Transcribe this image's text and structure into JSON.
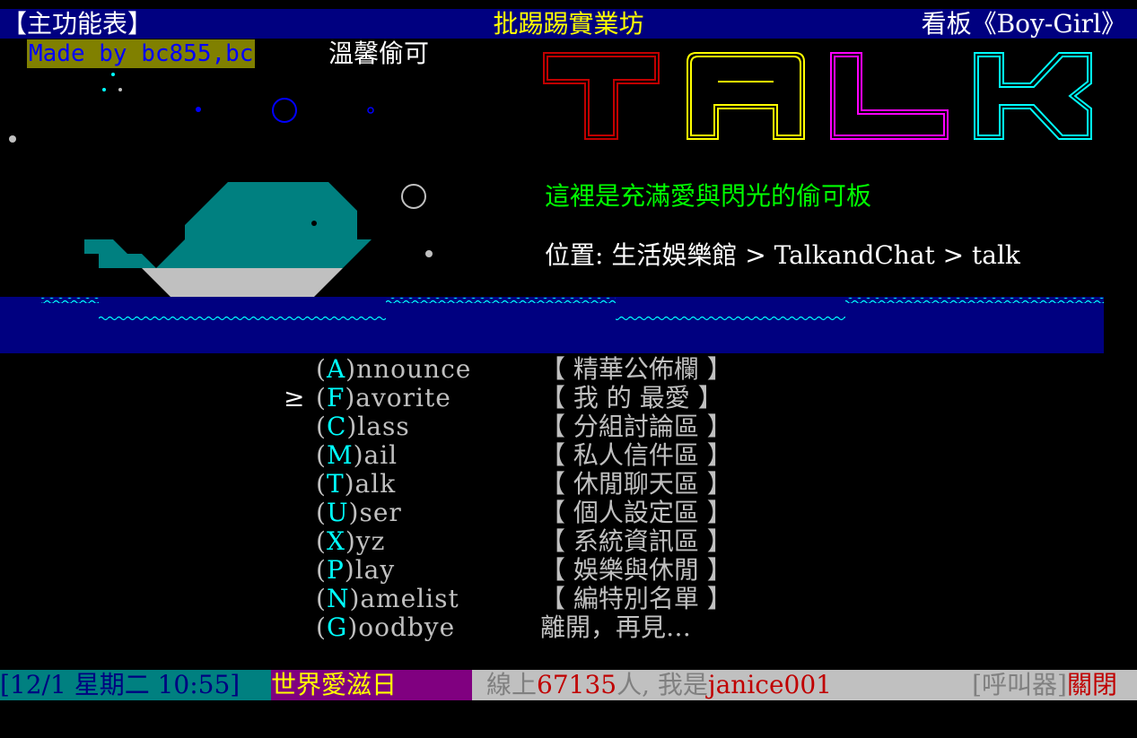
{
  "header": {
    "left": "【主功能表】",
    "center": "批踢踢實業坊",
    "right": "看板《Boy-Girl》"
  },
  "banner": {
    "made_by": "Made by bc855,bc",
    "subtitle": "溫馨偷可",
    "logo_text": "TALK",
    "tagline": "這裡是充滿愛與閃光的偷可板",
    "location": "位置: 生活娛樂館 > TalkandChat > talk"
  },
  "colors": {
    "header_bg": "#000080",
    "sea": "#000080",
    "whale": "#008080",
    "logo_t": "#c00000",
    "logo_a": "#ffff00",
    "logo_l": "#ff00ff",
    "logo_k": "#00ffff"
  },
  "menu": {
    "cursor": "≥",
    "selected_index": 1,
    "items": [
      {
        "open": "(",
        "key": "A",
        "rest": ")nnounce",
        "desc": "【 精華公佈欄 】"
      },
      {
        "open": "(",
        "key": "F",
        "rest": ")avorite",
        "desc": "【 我 的 最愛 】"
      },
      {
        "open": "(",
        "key": "C",
        "rest": ")lass",
        "desc": "【 分組討論區 】"
      },
      {
        "open": "(",
        "key": "M",
        "rest": ")ail",
        "desc": "【 私人信件區 】"
      },
      {
        "open": "(",
        "key": "T",
        "rest": ")alk",
        "desc": "【 休閒聊天區 】"
      },
      {
        "open": "(",
        "key": "U",
        "rest": ")ser",
        "desc": "【 個人設定區 】"
      },
      {
        "open": "(",
        "key": "X",
        "rest": ")yz",
        "desc": "【 系統資訊區 】"
      },
      {
        "open": "(",
        "key": "P",
        "rest": ")lay",
        "desc": "【 娛樂與休閒 】"
      },
      {
        "open": "(",
        "key": "N",
        "rest": ")amelist",
        "desc": "【 編特別名單 】"
      },
      {
        "open": "(",
        "key": "G",
        "rest": ")oodbye",
        "desc": "   離開，再見…"
      }
    ]
  },
  "status": {
    "datetime": "[12/1 星期二 10:55]",
    "event": "世界愛滋日",
    "online_prefix": "線上",
    "online_count": "67135",
    "online_mid": "人, 我是",
    "username": "janice001",
    "pager_label": "[呼叫器]",
    "pager_state": "關閉"
  }
}
